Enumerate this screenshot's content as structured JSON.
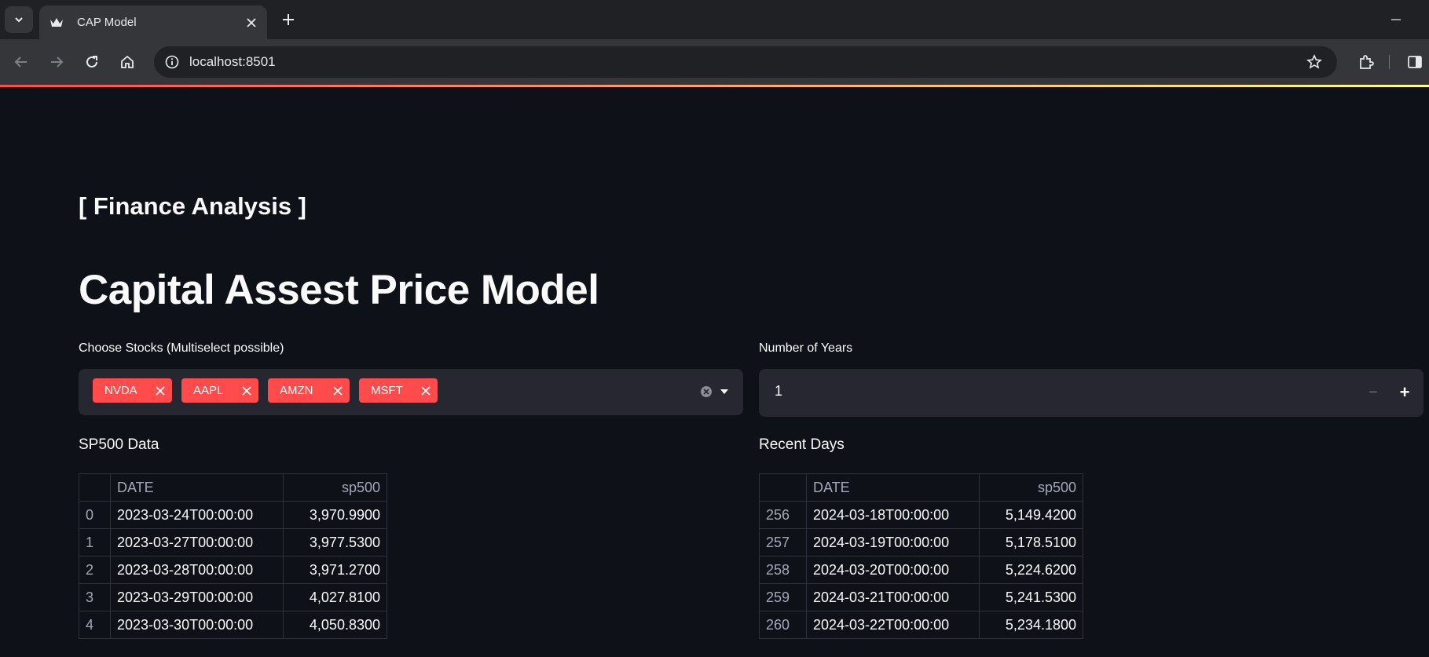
{
  "browser": {
    "tab_title": "CAP Model",
    "url": "localhost:8501"
  },
  "page": {
    "subtitle": "[ Finance Analysis ]",
    "title": "Capital Assest Price Model"
  },
  "stocks_select": {
    "label": "Choose Stocks (Multiselect possible)",
    "selected": [
      "NVDA",
      "AAPL",
      "AMZN",
      "MSFT"
    ]
  },
  "years_input": {
    "label": "Number of Years",
    "value": "1",
    "minus": "−",
    "plus": "+"
  },
  "sp500_table": {
    "heading": "SP500 Data",
    "columns": [
      "",
      "DATE",
      "sp500"
    ],
    "rows": [
      [
        "0",
        "2023-03-24T00:00:00",
        "3,970.9900"
      ],
      [
        "1",
        "2023-03-27T00:00:00",
        "3,977.5300"
      ],
      [
        "2",
        "2023-03-28T00:00:00",
        "3,971.2700"
      ],
      [
        "3",
        "2023-03-29T00:00:00",
        "4,027.8100"
      ],
      [
        "4",
        "2023-03-30T00:00:00",
        "4,050.8300"
      ]
    ]
  },
  "recent_table": {
    "heading": "Recent Days",
    "columns": [
      "",
      "DATE",
      "sp500"
    ],
    "rows": [
      [
        "256",
        "2024-03-18T00:00:00",
        "5,149.4200"
      ],
      [
        "257",
        "2024-03-19T00:00:00",
        "5,178.5100"
      ],
      [
        "258",
        "2024-03-20T00:00:00",
        "5,224.6200"
      ],
      [
        "259",
        "2024-03-21T00:00:00",
        "5,241.5300"
      ],
      [
        "260",
        "2024-03-22T00:00:00",
        "5,234.1800"
      ]
    ]
  },
  "colors": {
    "chip": "#ff4b4b",
    "background": "#0e1117",
    "widget": "#262730"
  }
}
